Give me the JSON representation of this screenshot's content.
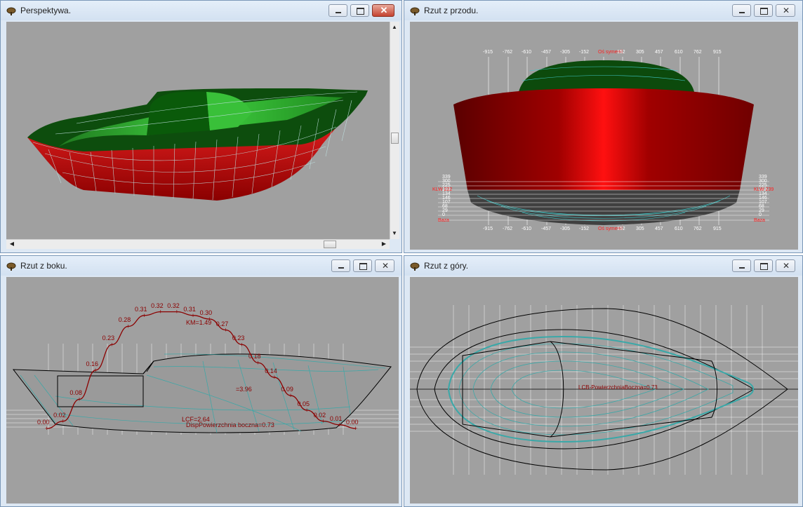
{
  "windows": {
    "perspective": {
      "title": "Perspektywa."
    },
    "front": {
      "title": "Rzut z przodu.",
      "x_ticks": [
        "-915",
        "-762",
        "-610",
        "-457",
        "-305",
        "-152",
        "Oś symetrii",
        "152",
        "305",
        "457",
        "610",
        "762",
        "915"
      ],
      "wl_values": [
        "339",
        "300",
        "225",
        "183",
        "134",
        "146",
        "107",
        "68",
        "29",
        "0"
      ],
      "left_labels": {
        "klw": "KLW 222",
        "base": "Baza"
      },
      "right_labels": {
        "klw": "KLW 239",
        "base": "Baza"
      }
    },
    "side": {
      "title": "Rzut z boku.",
      "curve_values": [
        "0.00",
        "0.02",
        "0.08",
        "0.16",
        "0.23",
        "0.28",
        "0.31",
        "0.32",
        "0.32",
        "0.31",
        "0.30",
        "0.27",
        "0.23",
        "0.18",
        "0.14",
        "0.09",
        "0.05",
        "0.02",
        "0.01",
        "0.00"
      ],
      "annotations": {
        "km": "KM=1.49",
        "v": "=3.96",
        "lcf": "LCF=2.64",
        "disp": "DispPowierzchnia boczna=0.73"
      }
    },
    "top": {
      "title": "Rzut z góry.",
      "annotation": "LCB-PowierzchniaBoczna=0.73"
    }
  },
  "colors": {
    "view_bg": "#a0a0a0",
    "hull_red": "#c40000",
    "deck_green": "#0e5a0e",
    "line_cyan": "#40c0c0",
    "curve_darkred": "#8b0000"
  }
}
